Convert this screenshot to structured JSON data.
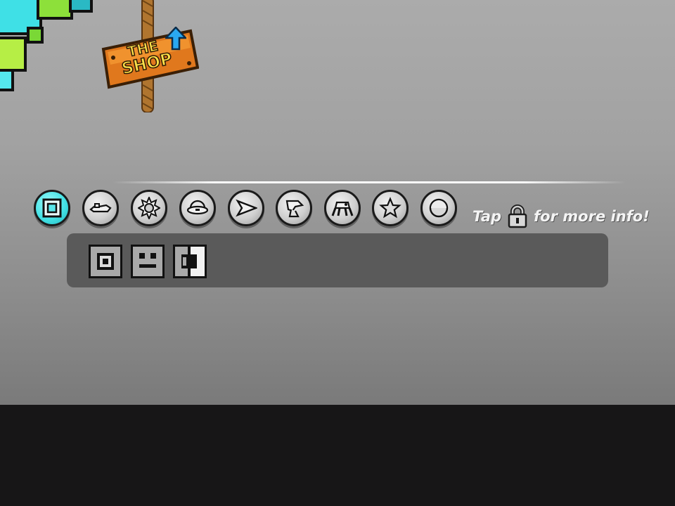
{
  "shop_sign": {
    "line1": "THE",
    "line2": "SHOP",
    "icon": "up-arrow-icon"
  },
  "categories": [
    {
      "name": "cube",
      "icon": "cube-icon",
      "selected": true
    },
    {
      "name": "ship",
      "icon": "ship-icon",
      "selected": false
    },
    {
      "name": "ball",
      "icon": "ball-icon",
      "selected": false
    },
    {
      "name": "ufo",
      "icon": "ufo-icon",
      "selected": false
    },
    {
      "name": "wave",
      "icon": "wave-icon",
      "selected": false
    },
    {
      "name": "robot",
      "icon": "robot-icon",
      "selected": false
    },
    {
      "name": "spider",
      "icon": "spider-icon",
      "selected": false
    },
    {
      "name": "star",
      "icon": "star-icon",
      "selected": false
    },
    {
      "name": "special",
      "icon": "circle-icon",
      "selected": false
    }
  ],
  "tap_info": {
    "prefix": "Tap",
    "suffix": "for more info!",
    "icon": "lock-icon"
  },
  "icons": [
    {
      "icon": "cube-default-icon"
    },
    {
      "icon": "cube-face-icon"
    },
    {
      "icon": "cube-bracket-icon"
    }
  ],
  "colors": {
    "accent": "#45e3e6",
    "background_top": "#ababab",
    "ground": "#171617",
    "panel": "#5a5a5a",
    "sign_wood": "#e07a1f"
  }
}
